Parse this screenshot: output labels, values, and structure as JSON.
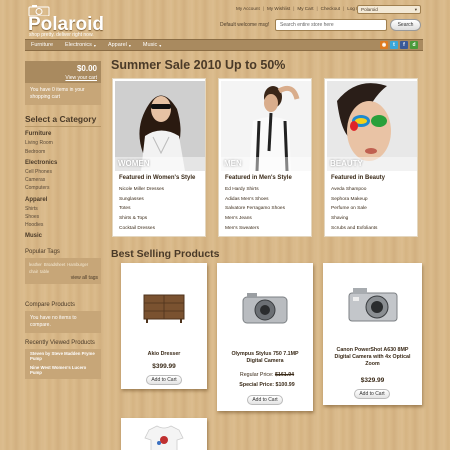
{
  "header": {
    "logo_title": "Polaroid",
    "logo_subtitle": "shop pretty. deliver right now.",
    "top_links": [
      "My Account",
      "My Wishlist",
      "My Cart",
      "Checkout",
      "Log In"
    ],
    "language": "Polaroid",
    "welcome": "Default welcome msg!",
    "search_placeholder": "Search entire store here",
    "search_button": "Search"
  },
  "nav": {
    "items": [
      {
        "label": "Furniture",
        "dropdown": false
      },
      {
        "label": "Electronics",
        "dropdown": true
      },
      {
        "label": "Apparel",
        "dropdown": true
      },
      {
        "label": "Music",
        "dropdown": true
      }
    ],
    "social_icons": [
      "rss-icon",
      "twitter-icon",
      "facebook-icon",
      "delicious-icon"
    ]
  },
  "sidebar": {
    "cart": {
      "amount": "$0.00",
      "view_link": "View your cart",
      "message": "You have 0 items in your shopping cart"
    },
    "category_title": "Select a Category",
    "categories": [
      {
        "name": "Furniture",
        "subs": [
          "Living Room",
          "Bedroom"
        ]
      },
      {
        "name": "Electronics",
        "subs": [
          "Cell Phones",
          "Cameras",
          "Computers"
        ]
      },
      {
        "name": "Apparel",
        "subs": [
          "Shirts",
          "Shoes",
          "Hoodies"
        ]
      },
      {
        "name": "Music",
        "subs": []
      }
    ],
    "popular_tags_title": "Popular Tags",
    "tags": [
      "leather",
      "Broadsheet",
      "Hamburger",
      "chair",
      "table"
    ],
    "view_all_tags": "view all tags",
    "compare_title": "Compare Products",
    "compare_message": "You have no items to compare.",
    "recent_title": "Recently Viewed Products",
    "recent_items": [
      "Steven by Steve Madden Pryme Pump",
      "Nine West Women's Lucero Pump"
    ]
  },
  "main": {
    "sale_title": "Summer Sale 2010 Up to 50%",
    "promos": [
      {
        "label": "WOMEN",
        "heading": "Featured in Women's Style",
        "items": [
          "Nicole Miller Dresses",
          "Sunglasses",
          "Totes",
          "Shirts & Tops",
          "Cocktail Dresses"
        ]
      },
      {
        "label": "MEN",
        "heading": "Featured in Men's Style",
        "items": [
          "Ed Hardy Shirts",
          "Adidas Men's Shoes",
          "Salvatore Ferragamo Shoes",
          "Men's Jeans",
          "Men's Sweaters"
        ]
      },
      {
        "label": "BEAUTY",
        "heading": "Featured in Beauty",
        "items": [
          "Aveda Shampoo",
          "Sephora Makeup",
          "Perfume on Sale",
          "Shaving",
          "Scrubs and Exfoliants"
        ]
      }
    ],
    "best_title": "Best Selling Products",
    "products": [
      {
        "name": "Akio Dresser",
        "price": "$399.99",
        "button": "Add to Cart"
      },
      {
        "name": "Olympus Stylus 750 7.1MP Digital Camera",
        "regular_label": "Regular Price:",
        "regular_price": "$161.94",
        "special_label": "Special Price:",
        "special_price": "$100.99",
        "button": "Add to Cart"
      },
      {
        "name": "Canon PowerShot A630 8MP Digital Camera with 4x Optical Zoom",
        "price": "$329.99",
        "button": "Add to Cart"
      }
    ]
  }
}
